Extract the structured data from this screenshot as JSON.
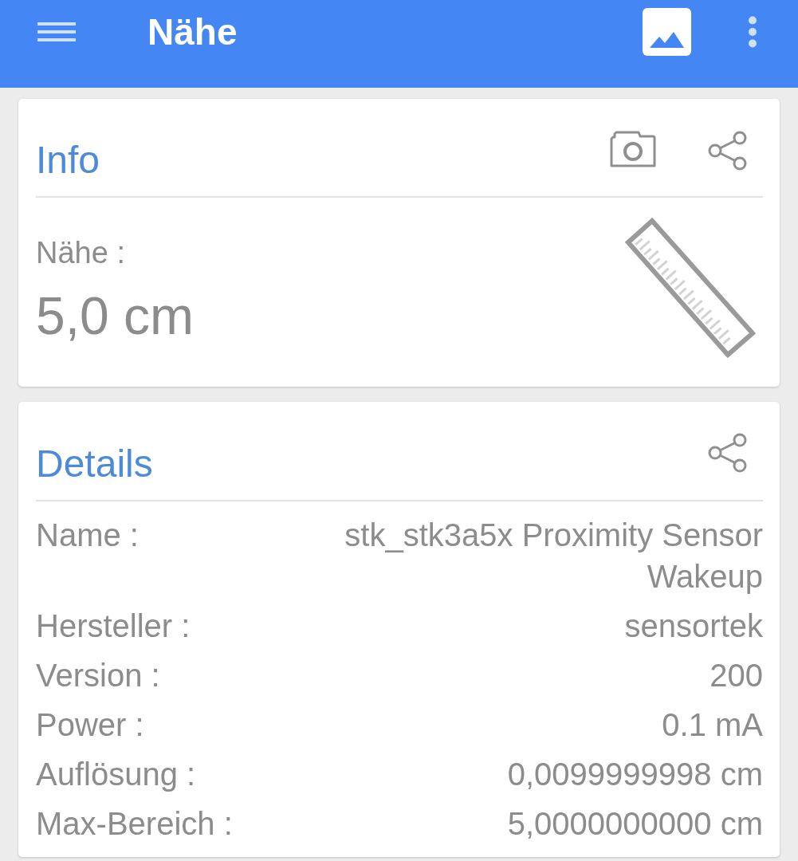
{
  "app_bar": {
    "title": "Nähe"
  },
  "info_card": {
    "title": "Info",
    "label": "Nähe :",
    "value": "5,0 cm"
  },
  "details_card": {
    "title": "Details",
    "rows": [
      {
        "label": "Name :",
        "value": "stk_stk3a5x Proximity Sensor Wakeup"
      },
      {
        "label": "Hersteller :",
        "value": "sensortek"
      },
      {
        "label": "Version :",
        "value": "200"
      },
      {
        "label": "Power :",
        "value": "0.1 mA"
      },
      {
        "label": "Auflösung :",
        "value": "0,0099999998 cm"
      },
      {
        "label": "Max-Bereich :",
        "value": "5,0000000000 cm"
      }
    ]
  }
}
